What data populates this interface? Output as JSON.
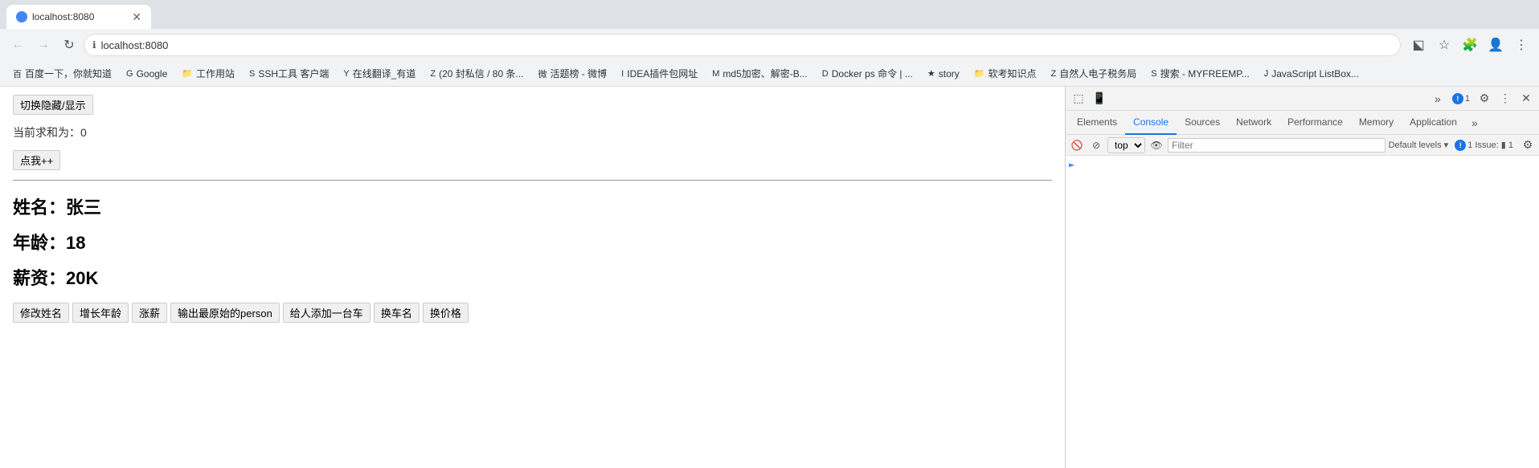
{
  "browser": {
    "url": "localhost:8080",
    "tab_title": "localhost:8080",
    "nav": {
      "back_disabled": true,
      "forward_disabled": true
    }
  },
  "bookmarks": [
    {
      "label": "百度一下，你就知道",
      "icon": "★"
    },
    {
      "label": "Google",
      "icon": "G"
    },
    {
      "label": "工作用站",
      "icon": "📁"
    },
    {
      "label": "SSH工具 客户端",
      "icon": "S"
    },
    {
      "label": "在线翻译_有道",
      "icon": "Y"
    },
    {
      "label": "(20 封私信 / 80 条...",
      "icon": "Z"
    },
    {
      "label": "活题榜 - 微博",
      "icon": "微"
    },
    {
      "label": "IDEA插件包网址",
      "icon": "I"
    },
    {
      "label": "md5加密、解密-B...",
      "icon": "M"
    },
    {
      "label": "Docker ps 命令 | ...",
      "icon": "D"
    },
    {
      "label": "story",
      "icon": "★"
    },
    {
      "label": "软考知识点",
      "icon": "📁"
    },
    {
      "label": "自然人电子税务局",
      "icon": "Z"
    },
    {
      "label": "搜索 - MYFREEMP...",
      "icon": "S"
    },
    {
      "label": "JavaScript ListBox...",
      "icon": "J"
    }
  ],
  "page": {
    "toggle_button_label": "切换隐藏/显示",
    "sum_label": "当前求和为：",
    "sum_value": "0",
    "increment_button_label": "点我++",
    "name_label": "姓名：",
    "name_value": "张三",
    "age_label": "年龄：",
    "age_value": "18",
    "salary_label": "薪资：",
    "salary_value": "20K",
    "action_buttons": [
      {
        "label": "修改姓名"
      },
      {
        "label": "增长年龄"
      },
      {
        "label": "涨薪"
      },
      {
        "label": "输出最原始的person"
      },
      {
        "label": "给人添加一台车"
      },
      {
        "label": "换车名"
      },
      {
        "label": "换价格"
      }
    ]
  },
  "devtools": {
    "tabs": [
      {
        "label": "Elements"
      },
      {
        "label": "Console",
        "active": true
      },
      {
        "label": "Sources"
      },
      {
        "label": "Network"
      },
      {
        "label": "Performance"
      },
      {
        "label": "Memory"
      },
      {
        "label": "Application"
      }
    ],
    "console": {
      "context": "top",
      "filter_placeholder": "Filter",
      "log_levels_label": "Default levels ▾",
      "issue_count": "1",
      "issue_label": "1 Issue: ▮ 1"
    }
  }
}
